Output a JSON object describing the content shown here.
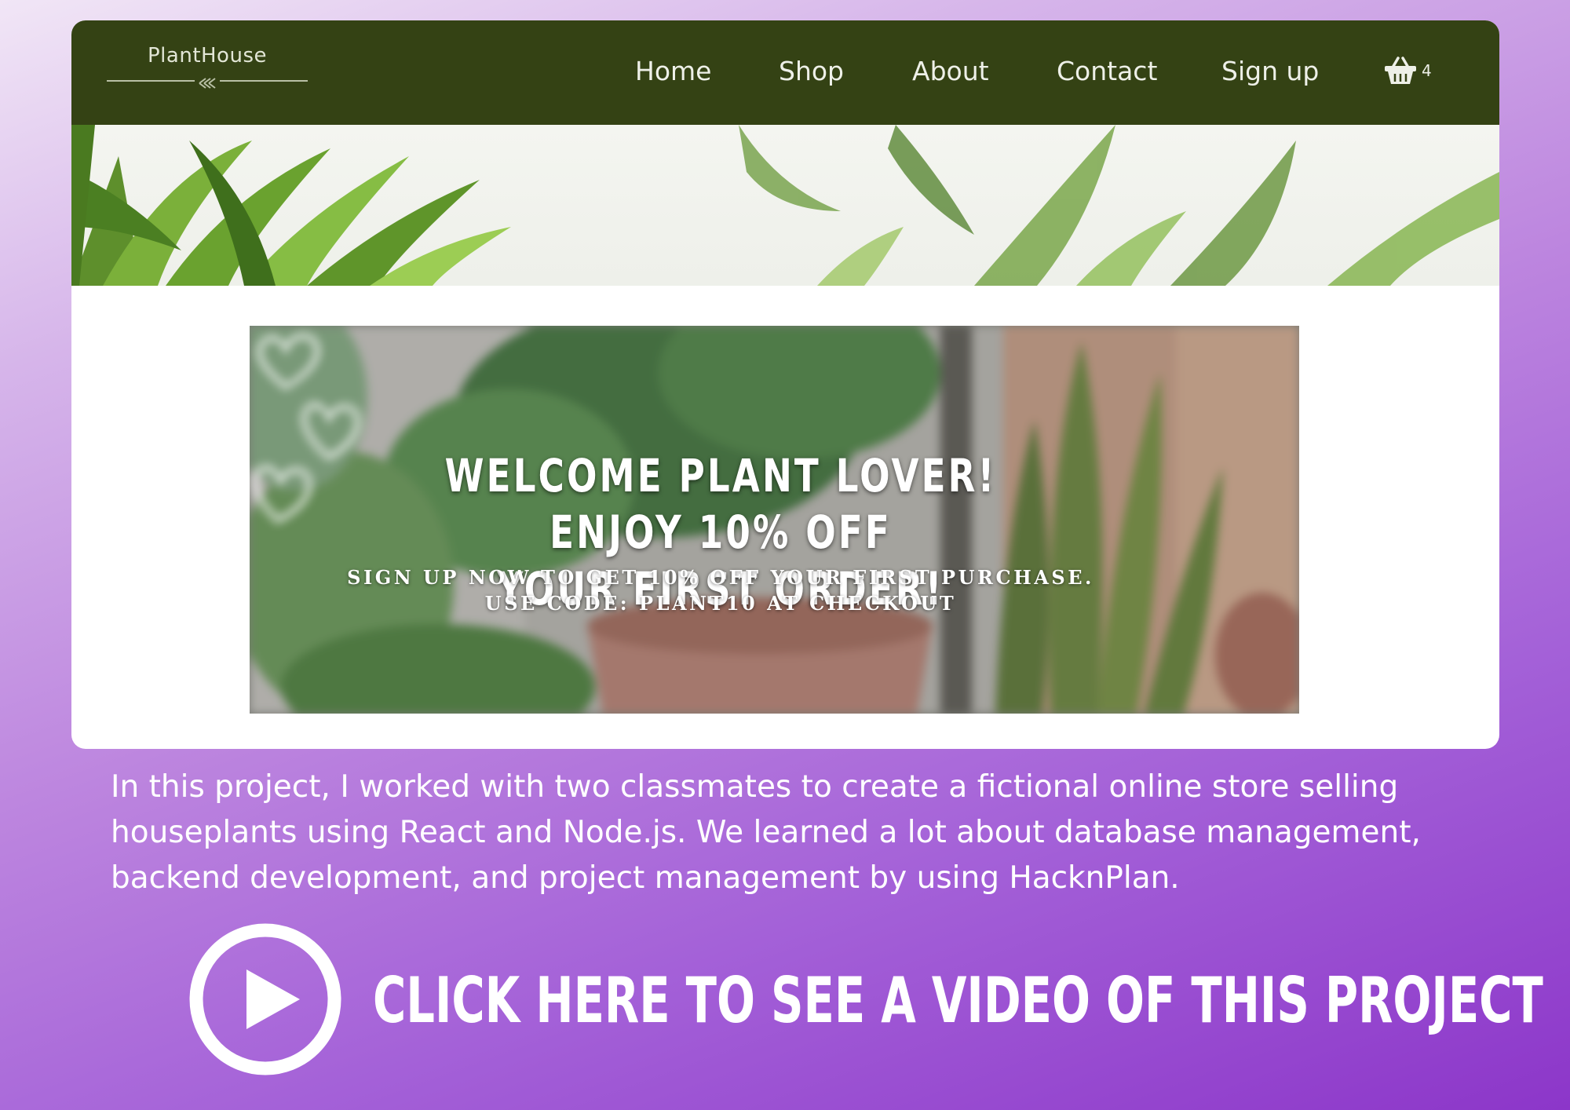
{
  "navbar": {
    "logo_text": "PlantHouse",
    "links": [
      "Home",
      "Shop",
      "About",
      "Contact",
      "Sign up"
    ],
    "cart_count": "4",
    "cart_icon": "basket-icon",
    "background_color": "#344214"
  },
  "banner": {
    "headline_line1": "WELCOME PLANT LOVER! ENJOY 10% OFF",
    "headline_line2": "YOUR FIRST ORDER!",
    "sub_line1": "SIGN UP NOW TO GET 10% OFF YOUR FIRST PURCHASE.",
    "sub_line2": "USE CODE: PLANT10 AT CHECKOUT",
    "decoration_icon": "hearts-icon"
  },
  "description": "In this project, I worked with two classmates to create a fictional online store selling houseplants using React and Node.js. We learned a lot about database management, backend development, and project management by using HacknPlan.",
  "cta": {
    "label": "CLICK HERE TO SEE A VIDEO OF THIS PROJECT",
    "icon": "play-icon"
  },
  "colors": {
    "background_gradient_start": "#f1e6f6",
    "background_gradient_end": "#8c36c9",
    "card_background": "#ffffff",
    "text_on_purple": "#ffffff"
  }
}
